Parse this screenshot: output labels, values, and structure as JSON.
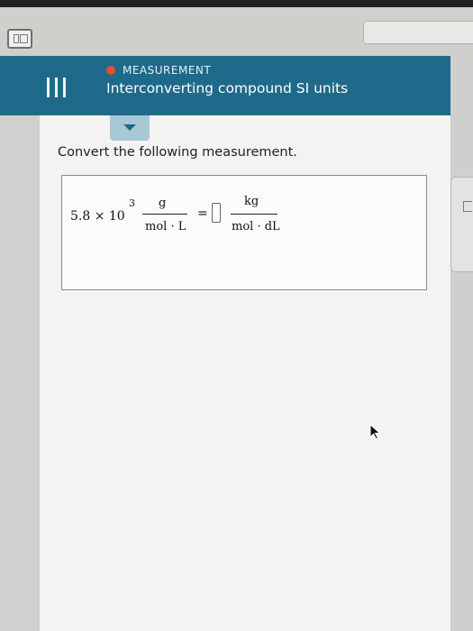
{
  "header": {
    "topic": "MEASUREMENT",
    "title": "Interconverting compound SI units"
  },
  "main": {
    "instruction": "Convert the following measurement.",
    "problem": {
      "coefficient": "5.8 × 10",
      "exponent": "3",
      "given_unit_numerator": "g",
      "given_unit_denominator": "mol · L",
      "equals": "=",
      "answer_value": "",
      "target_unit_numerator": "kg",
      "target_unit_denominator": "mol · dL"
    }
  },
  "icons": {
    "sidebar_toggle": "sidebar-toggle-icon",
    "menu": "hamburger-menu-icon",
    "collapse": "chevron-down-icon",
    "status_dot": "status-dot-icon",
    "right_tool": "panel-tool-icon",
    "pointer": "mouse-pointer-icon"
  },
  "colors": {
    "header_bg": "#1f6a8a",
    "topic_dot": "#e5502f",
    "collapse_tab": "#a9c8d6",
    "content_bg": "#f3f3f1"
  }
}
